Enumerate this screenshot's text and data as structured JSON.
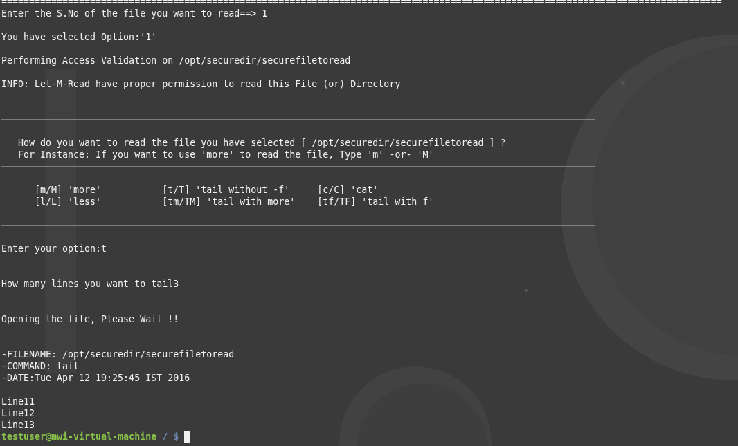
{
  "terminal": {
    "lines": [
      {
        "kind": "text",
        "text": "=================================================================================================================================="
      },
      {
        "kind": "text",
        "text": "Enter the S.No of the file you want to read==> 1"
      },
      {
        "kind": "blank"
      },
      {
        "kind": "text",
        "text": "You have selected Option:'1'"
      },
      {
        "kind": "blank"
      },
      {
        "kind": "text",
        "text": "Performing Access Validation on /opt/securedir/securefiletoread"
      },
      {
        "kind": "blank"
      },
      {
        "kind": "text",
        "text": "INFO: Let-M-Read have proper permission to read this File (or) Directory"
      },
      {
        "kind": "blank"
      },
      {
        "kind": "blank"
      },
      {
        "kind": "rule"
      },
      {
        "kind": "blank"
      },
      {
        "kind": "indented",
        "text": "How do you want to read the file you have selected [ /opt/securedir/securefiletoread ] ?"
      },
      {
        "kind": "indented",
        "text": "For Instance: If you want to use 'more' to read the file, Type 'm' -or- 'M'"
      },
      {
        "kind": "rule"
      },
      {
        "kind": "blank"
      },
      {
        "kind": "options",
        "cells": [
          "[m/M] 'more'",
          "[t/T] 'tail without -f'",
          "[c/C] 'cat'"
        ]
      },
      {
        "kind": "options",
        "cells": [
          "[l/L] 'less'",
          "[tm/TM] 'tail with more'",
          "[tf/TF] 'tail with f'"
        ]
      },
      {
        "kind": "blank"
      },
      {
        "kind": "rule"
      },
      {
        "kind": "blank"
      },
      {
        "kind": "text",
        "text": "Enter your option:t"
      },
      {
        "kind": "blank"
      },
      {
        "kind": "blank"
      },
      {
        "kind": "text",
        "text": "How many lines you want to tail3"
      },
      {
        "kind": "blank"
      },
      {
        "kind": "blank"
      },
      {
        "kind": "text",
        "text": "Opening the file, Please Wait !!"
      },
      {
        "kind": "blank"
      },
      {
        "kind": "blank"
      },
      {
        "kind": "text",
        "text": "-FILENAME: /opt/securedir/securefiletoread"
      },
      {
        "kind": "text",
        "text": "-COMMAND: tail"
      },
      {
        "kind": "text",
        "text": "-DATE:Tue Apr 12 19:25:45 IST 2016"
      },
      {
        "kind": "blank"
      },
      {
        "kind": "text",
        "text": "Line11"
      },
      {
        "kind": "text",
        "text": "Line12"
      },
      {
        "kind": "text",
        "text": "Line13"
      },
      {
        "kind": "prompt",
        "user_host": "testuser@mwi-virtual-machine",
        "path": "/",
        "symbol": "$"
      }
    ]
  }
}
